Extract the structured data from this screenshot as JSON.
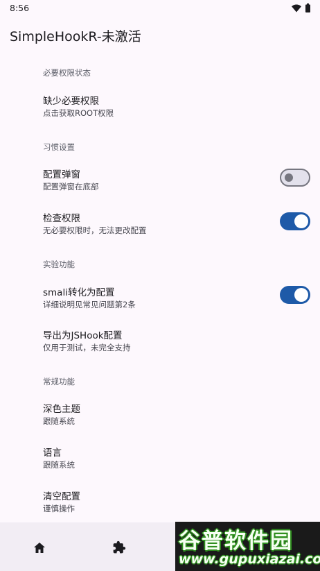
{
  "status_bar": {
    "time": "8:56"
  },
  "app": {
    "title": "SimpleHookR-未激活"
  },
  "sections": {
    "required_permissions": "必要权限状态",
    "habits": "习惯设置",
    "experimental": "实验功能",
    "general": "常规功能"
  },
  "prefs": {
    "missing_permissions": {
      "title": "缺少必要权限",
      "subtitle": "点击获取ROOT权限"
    },
    "config_popup": {
      "title": "配置弹窗",
      "subtitle": "配置弹窗在底部",
      "enabled": false
    },
    "check_permissions": {
      "title": "检查权限",
      "subtitle": "无必要权限时，无法更改配置",
      "enabled": true
    },
    "smali_convert": {
      "title": "smali转化为配置",
      "subtitle": "详细说明见常见问题第2条",
      "enabled": true
    },
    "export_jshook": {
      "title": "导出为JSHook配置",
      "subtitle": "仅用于测试，未完全支持"
    },
    "dark_theme": {
      "title": "深色主题",
      "subtitle": "跟随系统"
    },
    "language": {
      "title": "语言",
      "subtitle": "跟随系统"
    },
    "clear_config": {
      "title": "清空配置",
      "subtitle": "谨慎操作"
    }
  },
  "bottom_nav": {
    "icons": [
      "home-icon",
      "extension-icon"
    ]
  },
  "watermark": {
    "line1": "谷普软件园",
    "line2": "www.gupuxiazai.com"
  },
  "colors": {
    "accent": "#1e5aa8",
    "background": "#fdf8fd",
    "nav_background": "#f2edf4"
  }
}
